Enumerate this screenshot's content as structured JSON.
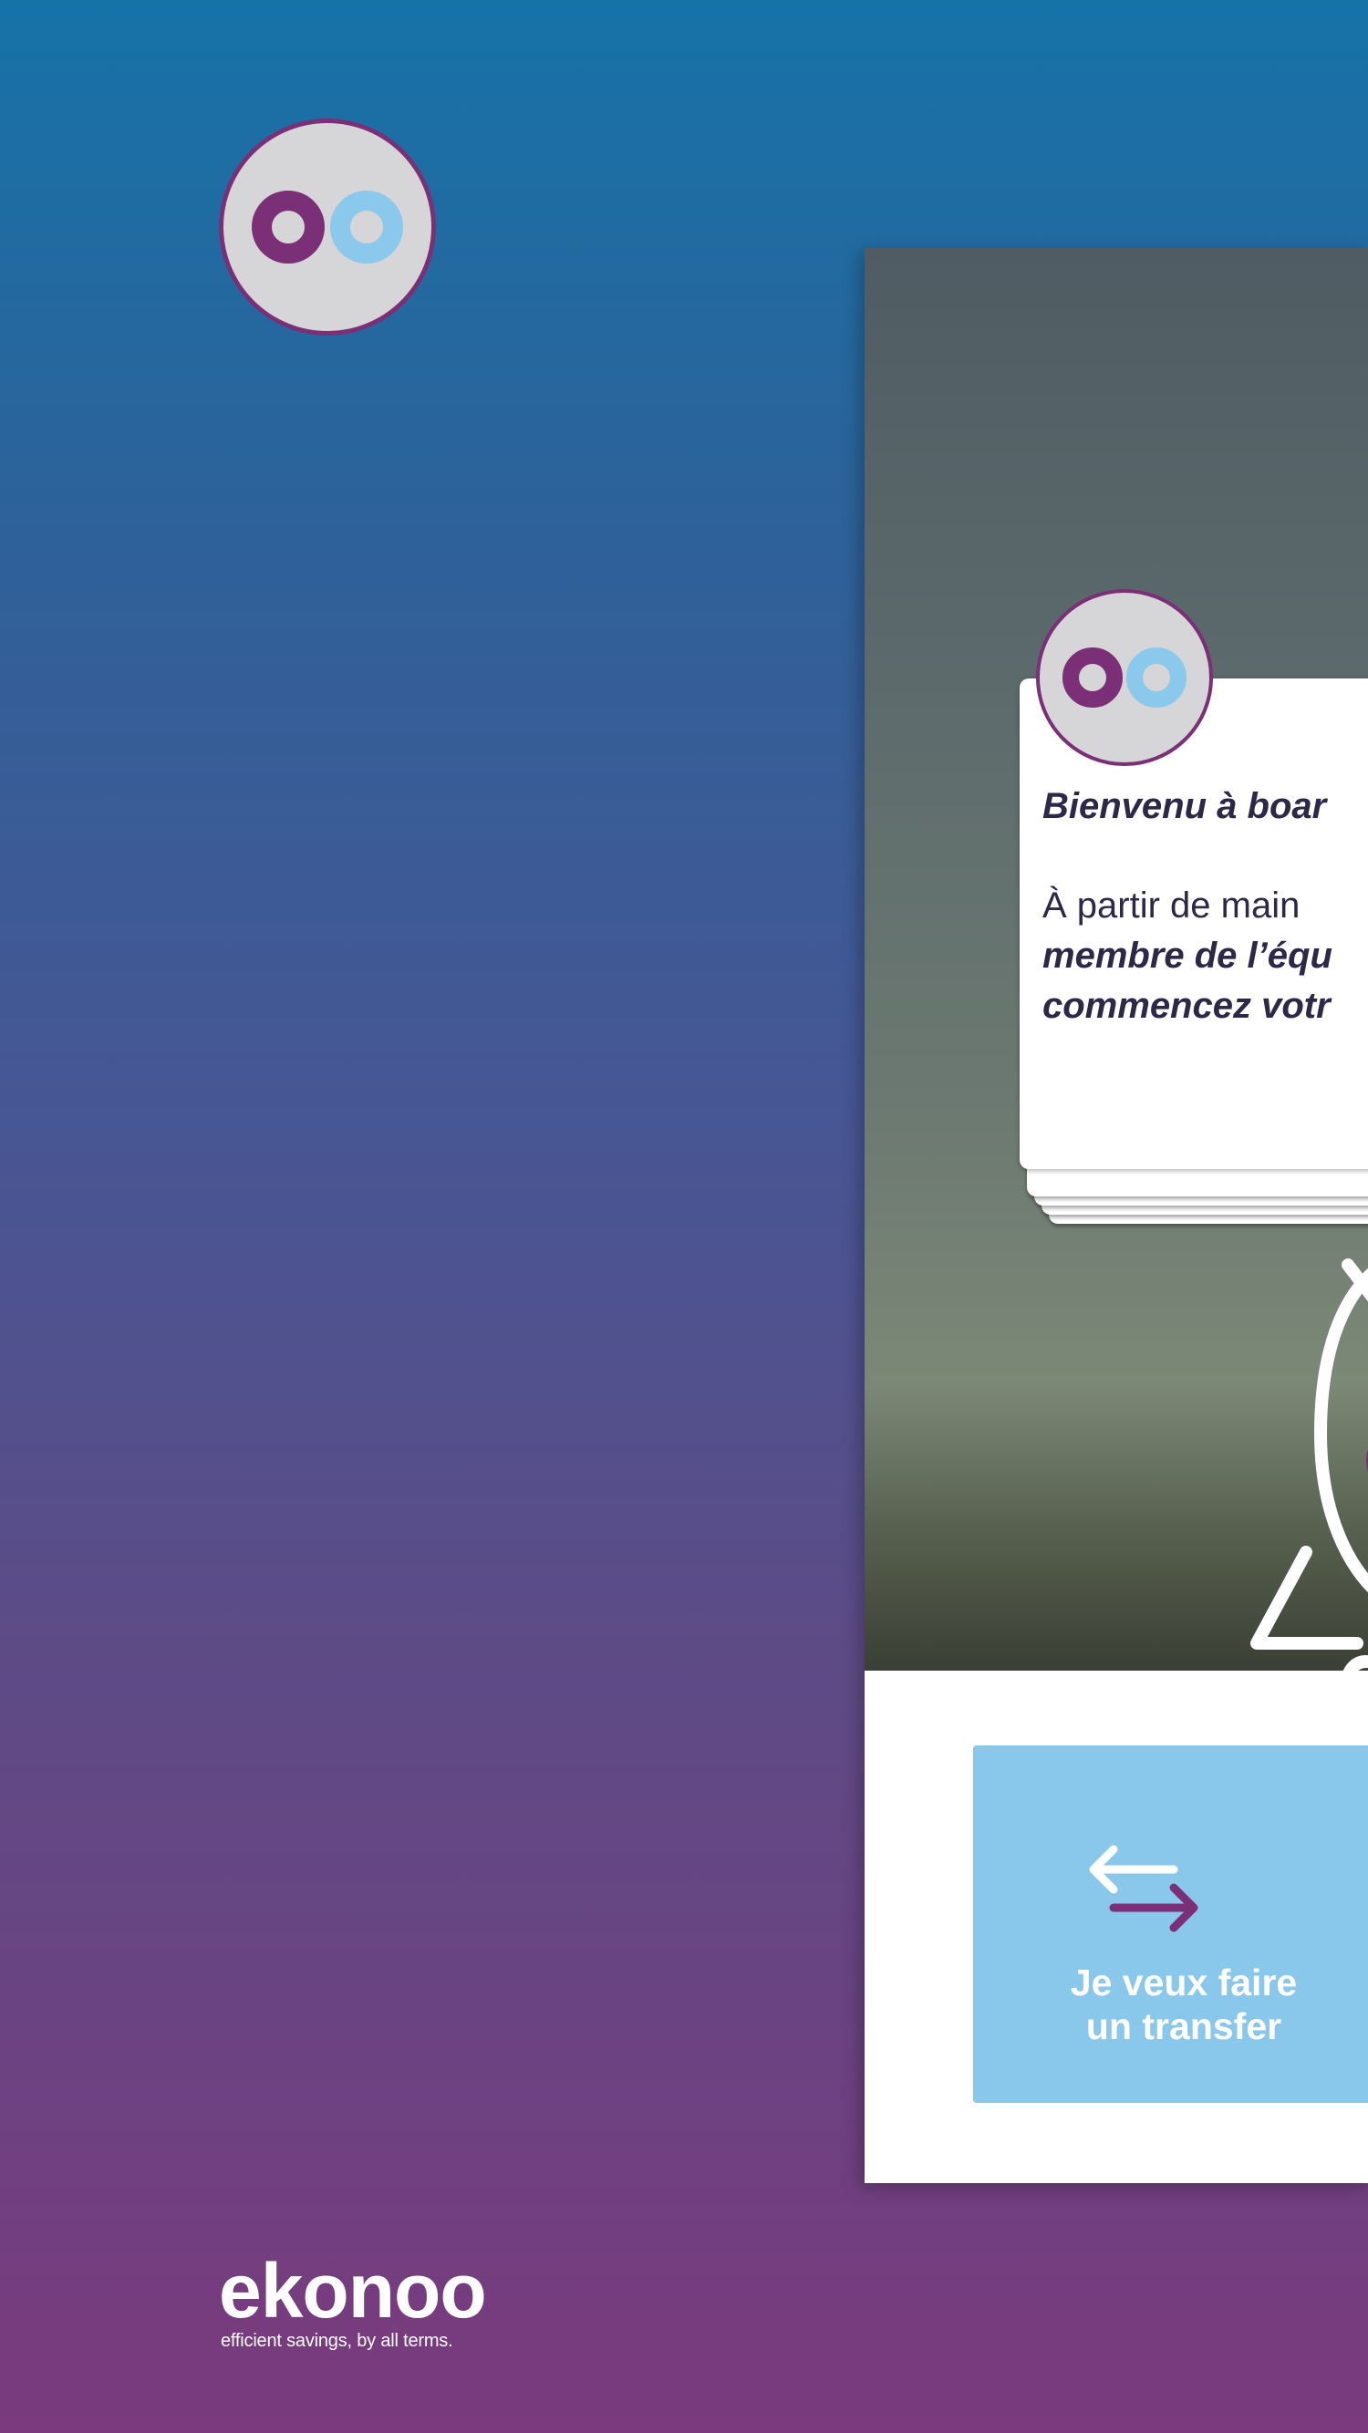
{
  "colors": {
    "brand_purple": "#7b2f77",
    "brand_light_blue": "#8ac8eb",
    "text_dark": "#2d2748",
    "gradient_top": "#1673a8",
    "gradient_bottom": "#7a3a7d"
  },
  "logo_badge": {
    "icon": "oo-logo-icon"
  },
  "chat": {
    "avatar_icon": "oo-logo-icon",
    "title": "Bienvenu à boar",
    "text_lead": "À partir de main",
    "text_emph_line1": "membre de l’équ",
    "text_emph_line2": "commencez votr"
  },
  "illustration": {
    "icon": "rocket-icon"
  },
  "transfer_button": {
    "icon": "transfer-arrows-icon",
    "label": "Je veux faire\nun transfer"
  },
  "brand": {
    "name": "ekonoo",
    "tagline": "efficient savings, by all terms."
  }
}
